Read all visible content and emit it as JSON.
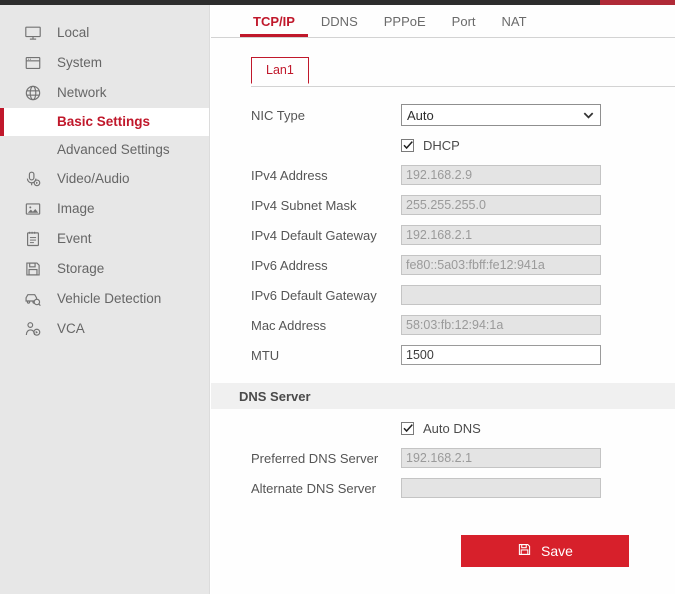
{
  "window": {
    "top_strip_color": "#2d2d2d",
    "top_accent_color": "#b02a37",
    "accent_color": "#c0182b"
  },
  "sidebar": {
    "items": [
      {
        "label": "Local",
        "icon": "monitor-icon",
        "type": "top"
      },
      {
        "label": "System",
        "icon": "window-icon",
        "type": "top"
      },
      {
        "label": "Network",
        "icon": "globe-icon",
        "type": "top"
      },
      {
        "label": "Basic Settings",
        "icon": "",
        "type": "sub",
        "active": true
      },
      {
        "label": "Advanced Settings",
        "icon": "",
        "type": "sub",
        "active": false
      },
      {
        "label": "Video/Audio",
        "icon": "microphone-icon",
        "type": "top"
      },
      {
        "label": "Image",
        "icon": "picture-icon",
        "type": "top"
      },
      {
        "label": "Event",
        "icon": "clipboard-icon",
        "type": "top"
      },
      {
        "label": "Storage",
        "icon": "floppy-disk-icon",
        "type": "top"
      },
      {
        "label": "Vehicle Detection",
        "icon": "car-search-icon",
        "type": "top"
      },
      {
        "label": "VCA",
        "icon": "person-detect-icon",
        "type": "top"
      }
    ]
  },
  "tabs": [
    {
      "label": "TCP/IP",
      "active": true
    },
    {
      "label": "DDNS",
      "active": false
    },
    {
      "label": "PPPoE",
      "active": false
    },
    {
      "label": "Port",
      "active": false
    },
    {
      "label": "NAT",
      "active": false
    }
  ],
  "subtab": {
    "label": "Lan1"
  },
  "form": {
    "nic_type": {
      "label": "NIC Type",
      "value": "Auto"
    },
    "dhcp": {
      "label": "DHCP",
      "checked": true
    },
    "ipv4_address": {
      "label": "IPv4 Address",
      "value": "192.168.2.9"
    },
    "ipv4_subnet_mask": {
      "label": "IPv4 Subnet Mask",
      "value": "255.255.255.0"
    },
    "ipv4_default_gateway": {
      "label": "IPv4 Default Gateway",
      "value": "192.168.2.1"
    },
    "ipv6_address": {
      "label": "IPv6 Address",
      "value": "fe80::5a03:fbff:fe12:941a"
    },
    "ipv6_default_gateway": {
      "label": "IPv6 Default Gateway",
      "value": ""
    },
    "mac_address": {
      "label": "Mac Address",
      "value": "58:03:fb:12:94:1a"
    },
    "mtu": {
      "label": "MTU",
      "value": "1500"
    }
  },
  "dns_section": {
    "title": "DNS Server",
    "auto_dns": {
      "label": "Auto DNS",
      "checked": true
    },
    "preferred_dns": {
      "label": "Preferred DNS Server",
      "value": "192.168.2.1"
    },
    "alternate_dns": {
      "label": "Alternate DNS Server",
      "value": ""
    }
  },
  "actions": {
    "save_label": "Save",
    "save_icon": "floppy-disk-icon",
    "save_color": "#d7202b"
  }
}
